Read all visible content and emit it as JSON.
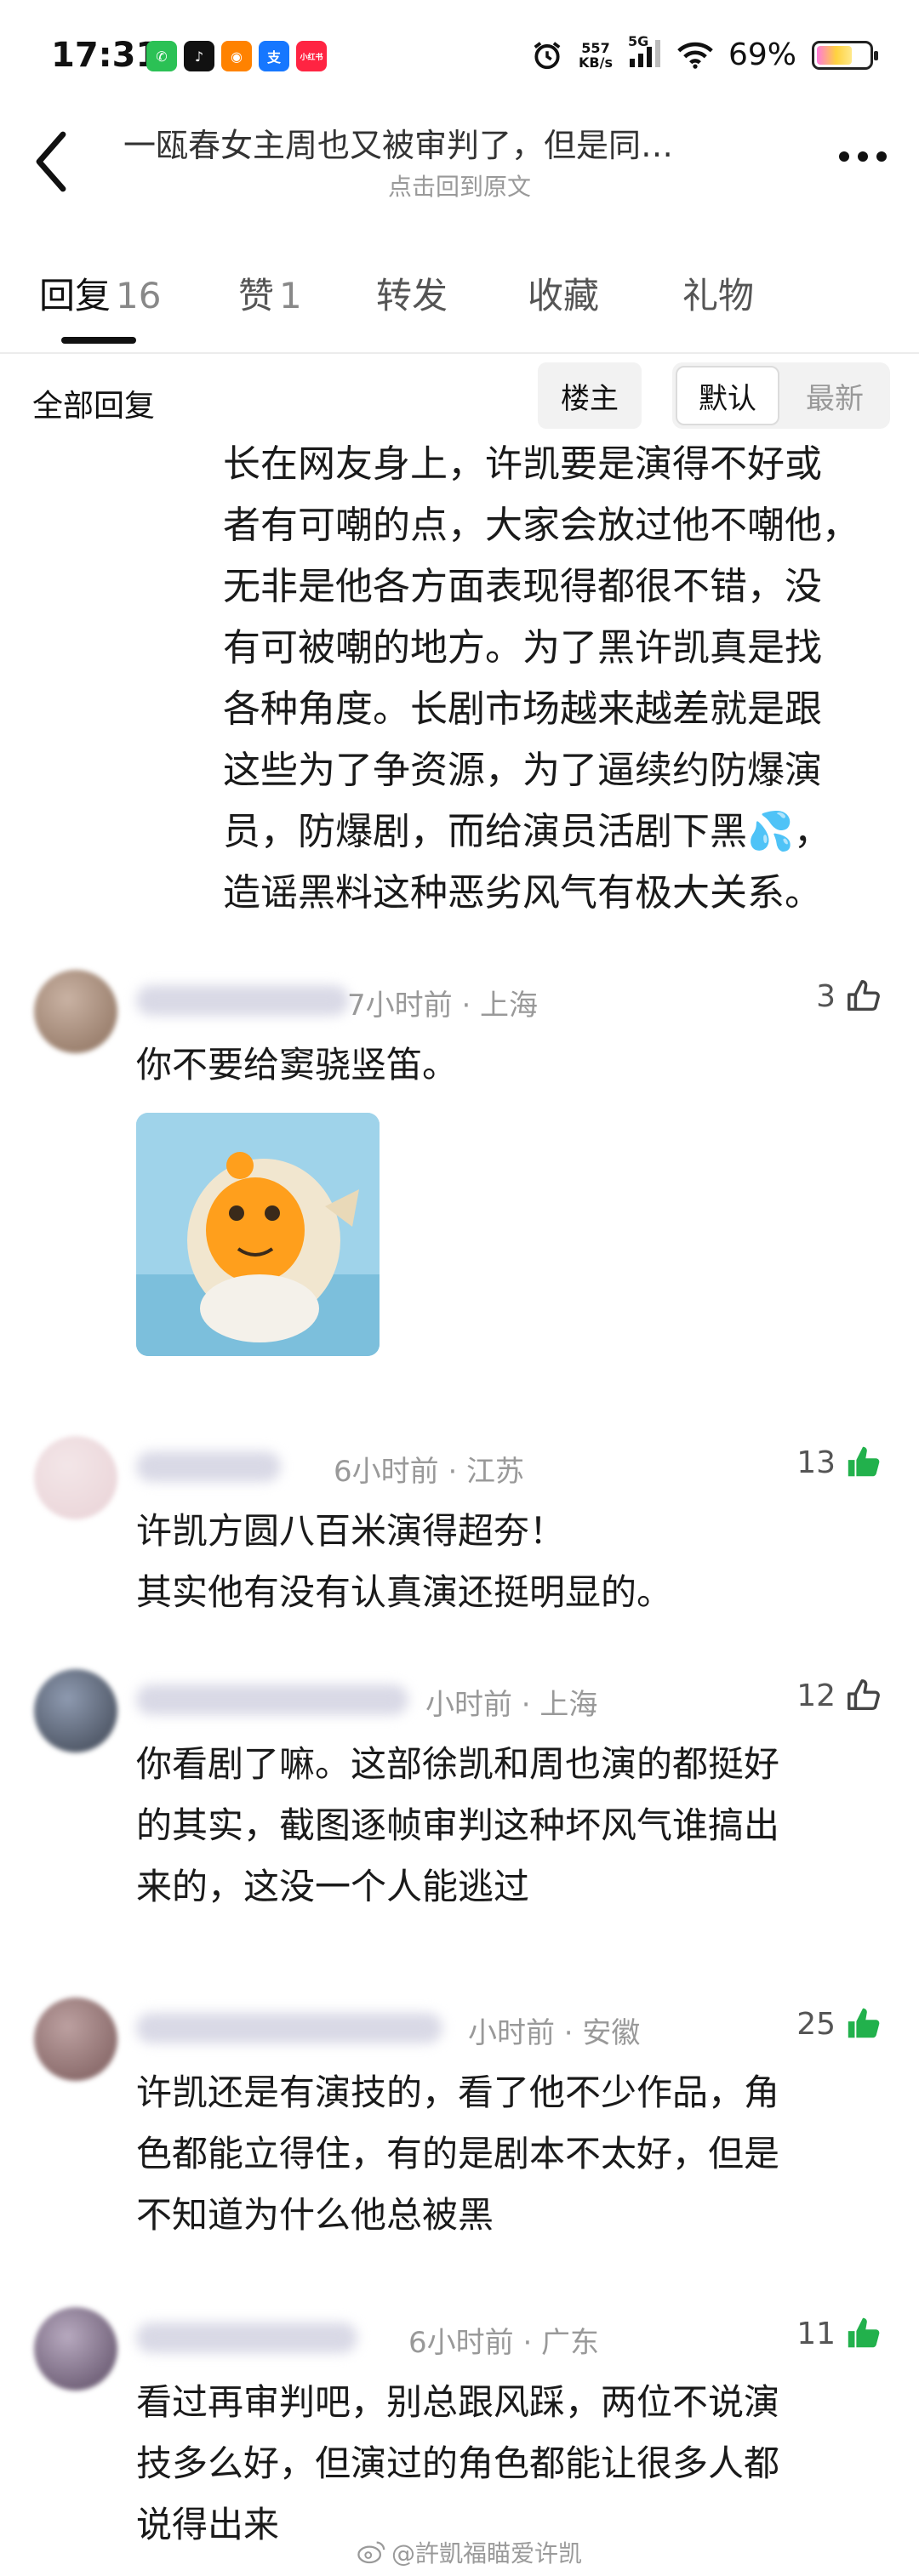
{
  "status_bar": {
    "time": "17:31",
    "net_speed_value": "557",
    "net_speed_unit": "KB/s",
    "signal": "5G",
    "battery_percent": "69%",
    "battery_level": 0.69,
    "app_icons": [
      {
        "name": "wechat-icon",
        "color": "#2bc155",
        "glyph": "✆"
      },
      {
        "name": "tiktok-icon",
        "color": "#111111",
        "glyph": "♪"
      },
      {
        "name": "weibo-icon",
        "color": "#ff8200",
        "glyph": "◉"
      },
      {
        "name": "alipay-icon",
        "color": "#1677ff",
        "glyph": "支"
      },
      {
        "name": "xiaohongshu-icon",
        "color": "#ff2442",
        "glyph": "小红书"
      }
    ]
  },
  "header": {
    "title": "一瓯春女主周也又被审判了，但是同…",
    "subtitle": "点击回到原文"
  },
  "tabs": [
    {
      "label": "回复",
      "count": "16"
    },
    {
      "label": "赞",
      "count": "1"
    },
    {
      "label": "转发",
      "count": ""
    },
    {
      "label": "收藏",
      "count": ""
    },
    {
      "label": "礼物",
      "count": ""
    }
  ],
  "filter": {
    "label": "全部回复",
    "owner": "楼主",
    "default": "默认",
    "latest": "最新"
  },
  "post_lines": [
    "长在网友身上，许凯要是演得不好或",
    "者有可嘲的点，大家会放过他不嘲他，",
    "无非是他各方面表现得都很不错，没",
    "有可被嘲的地方。为了黑许凯真是找",
    "各种角度。长剧市场越来越差就是跟",
    "这些为了争资源，为了逼续约防爆演",
    "员，防爆剧，而给演员活剧下黑💦，",
    "造谣黑料这种恶劣风气有极大关系。"
  ],
  "comments": [
    {
      "meta": "7小时前 · 上海",
      "likes": "3",
      "liked": false,
      "lines": [
        "你不要给窦骁竖笛。"
      ],
      "has_sticker": true
    },
    {
      "meta": "6小时前 · 江苏",
      "likes": "13",
      "liked": true,
      "lines": [
        "许凯方圆八百米演得超夯！",
        "其实他有没有认真演还挺明显的。"
      ]
    },
    {
      "meta": "小时前 · 上海",
      "likes": "12",
      "liked": false,
      "lines": [
        "你看剧了嘛。这部徐凯和周也演的都挺好",
        "的其实，截图逐帧审判这种坏风气谁搞出",
        "来的，这没一个人能逃过"
      ]
    },
    {
      "meta": "小时前 · 安徽",
      "likes": "25",
      "liked": true,
      "lines": [
        "许凯还是有演技的，看了他不少作品，角",
        "色都能立得住，有的是剧本不太好，但是",
        "不知道为什么他总被黑"
      ]
    },
    {
      "meta": "6小时前 · 广东",
      "likes": "11",
      "liked": true,
      "lines": [
        "看过再审判吧，别总跟风踩，两位不说演",
        "技多么好，但演过的角色都能让很多人都",
        "说得出来"
      ]
    }
  ],
  "watermark": "@許凱福瞄爱许凯",
  "colors": {
    "liked_green": "#22b14c",
    "muted": "#999999"
  }
}
